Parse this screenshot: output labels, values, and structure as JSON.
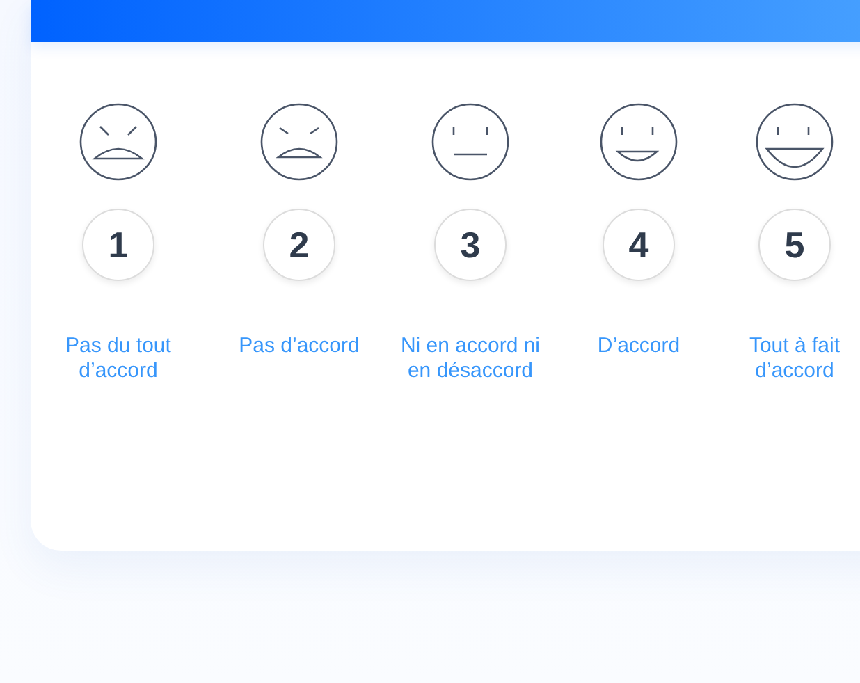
{
  "scale": [
    {
      "kind": "angry",
      "number": "1",
      "label": "Pas du tout d’accord"
    },
    {
      "kind": "sad",
      "number": "2",
      "label": "Pas d’accord"
    },
    {
      "kind": "neutral",
      "number": "3",
      "label": "Ni en accord ni en désaccord"
    },
    {
      "kind": "smile",
      "number": "4",
      "label": "D’accord"
    },
    {
      "kind": "grin",
      "number": "5",
      "label": "Tout à fait d’accord"
    }
  ]
}
